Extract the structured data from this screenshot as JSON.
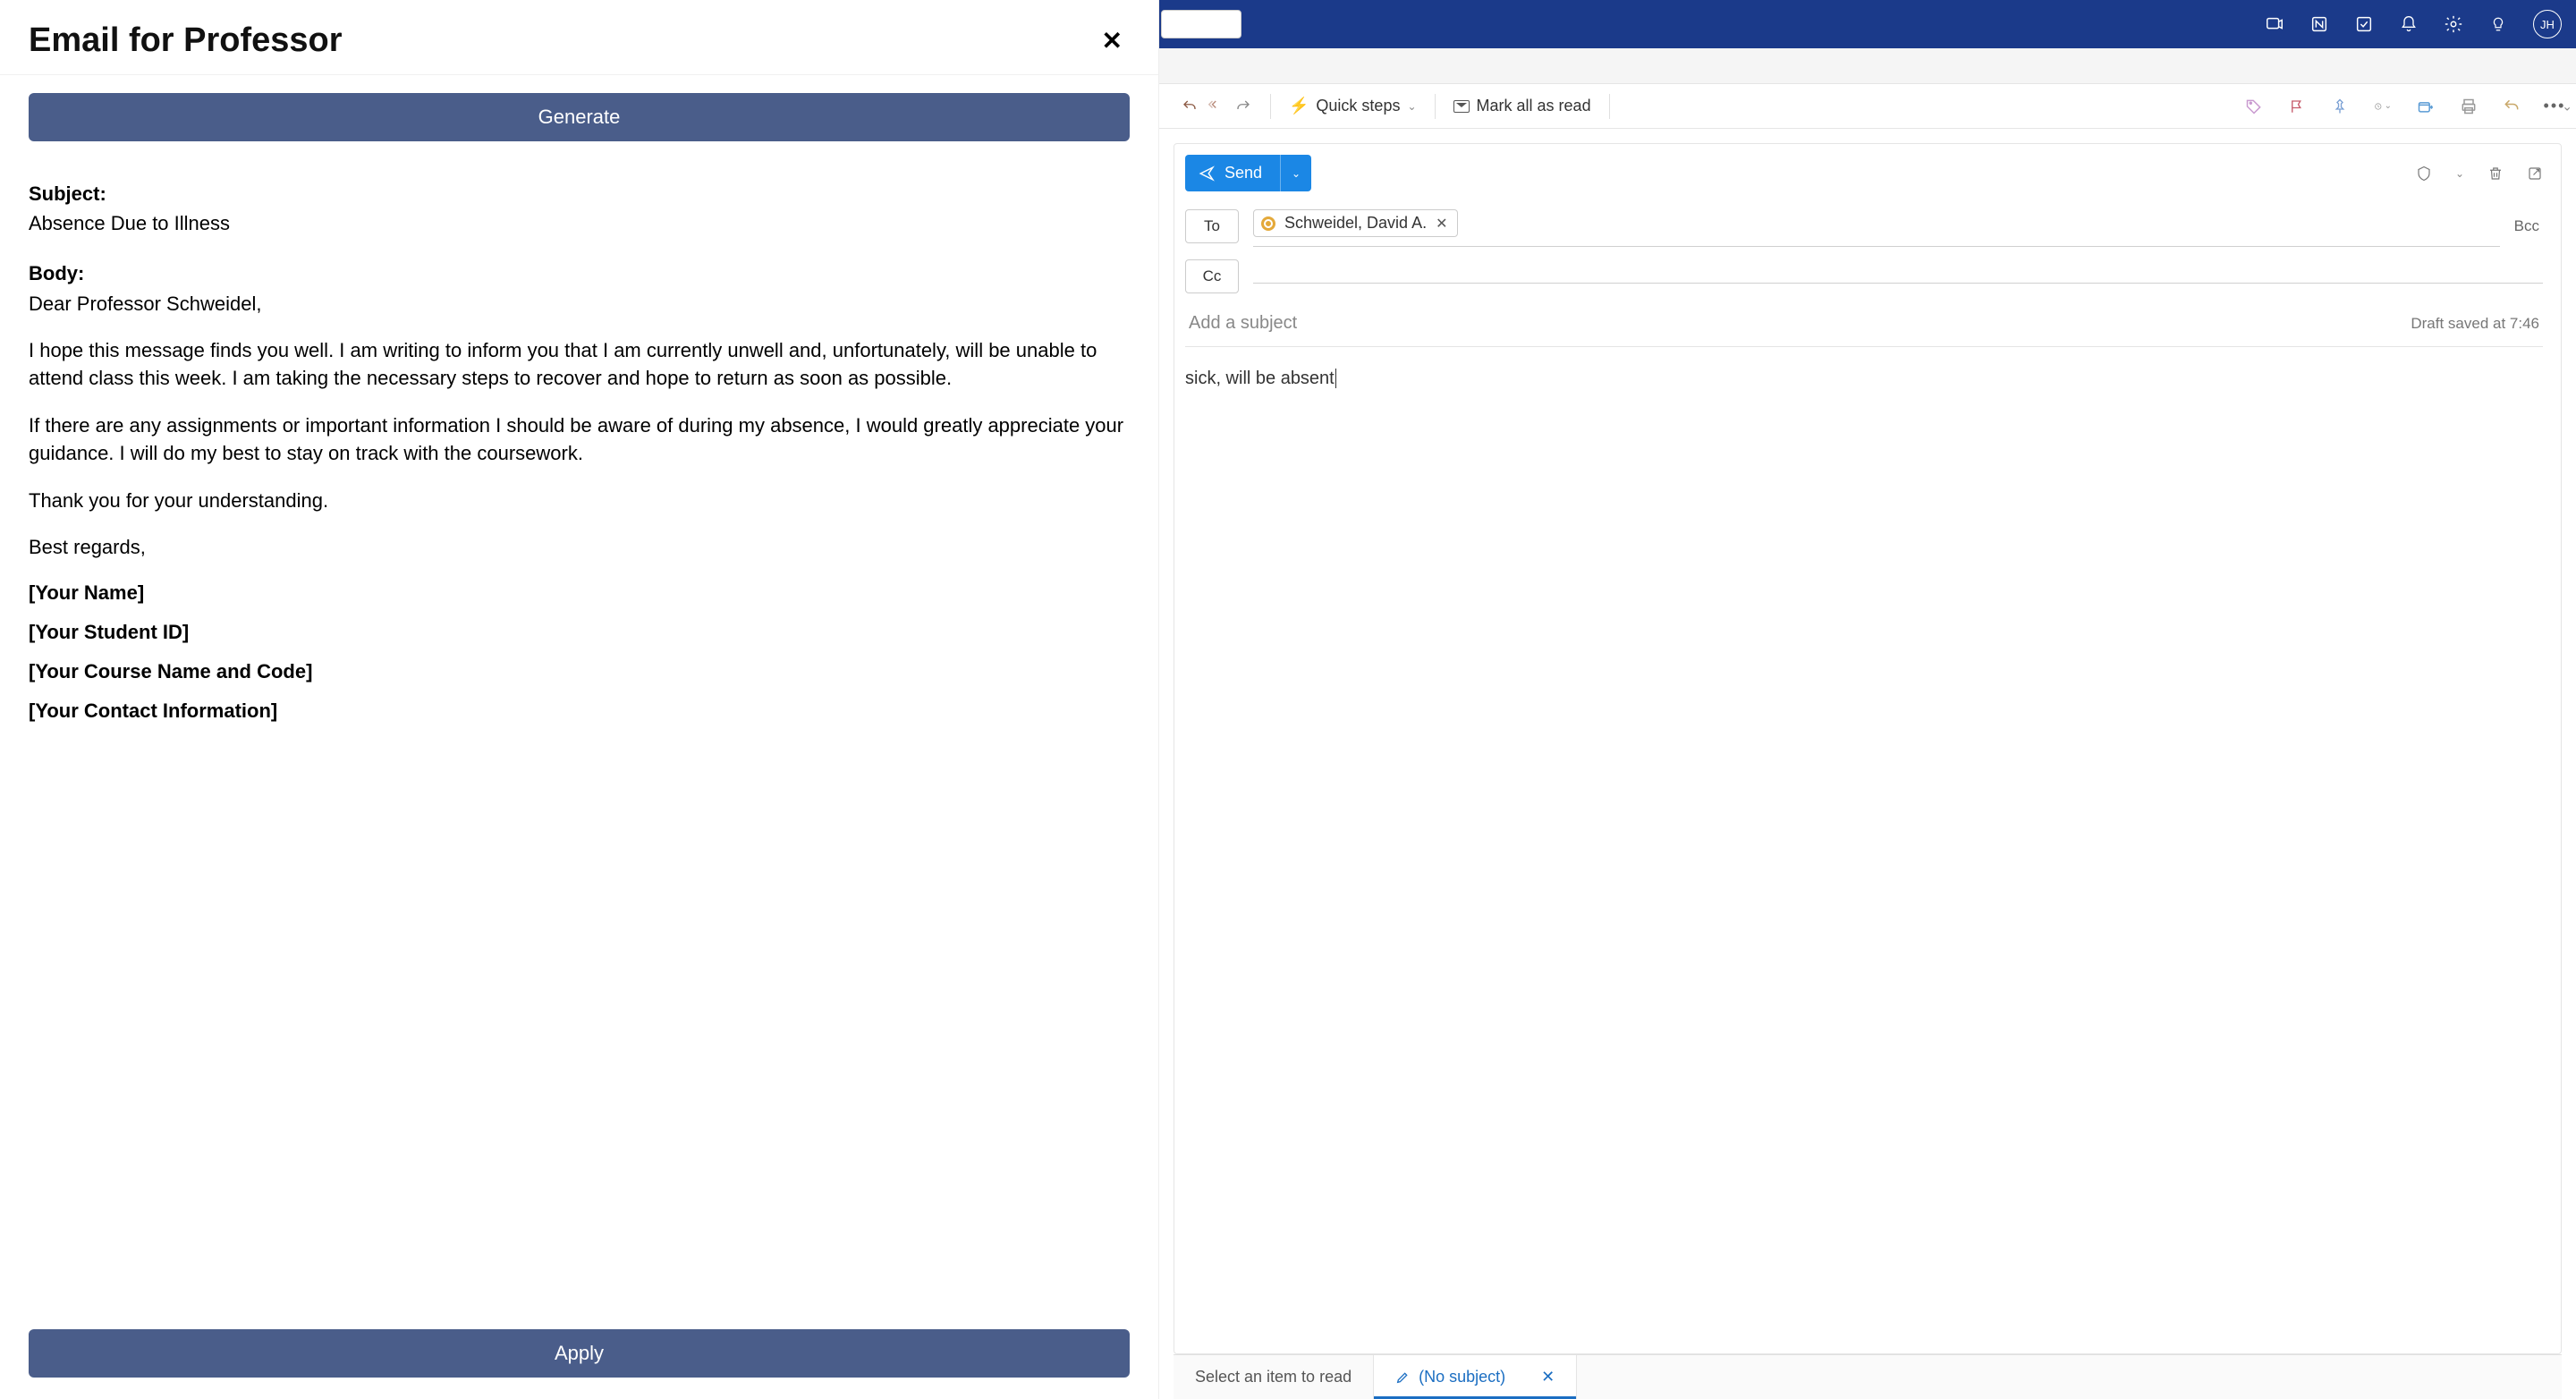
{
  "leftPanel": {
    "title": "Email for Professor",
    "generateLabel": "Generate",
    "subjectLabel": "Subject:",
    "subjectValue": "Absence Due to Illness",
    "bodyLabel": "Body:",
    "salutation": "Dear Professor Schweidel,",
    "para1": "I hope this message finds you well. I am writing to inform you that I am currently unwell and, unfortunately, will be unable to attend class this week. I am taking the necessary steps to recover and hope to return as soon as possible.",
    "para2": "If there are any assignments or important information I should be aware of during my absence, I would greatly appreciate your guidance. I will do my best to stay on track with the coursework.",
    "para3": "Thank you for your understanding.",
    "signoff": "Best regards,",
    "placeholders": {
      "name": "[Your Name]",
      "studentId": "[Your Student ID]",
      "course": "[Your Course Name and Code]",
      "contact": "[Your Contact Information]"
    },
    "applyLabel": "Apply"
  },
  "topbar": {
    "avatar": "JH"
  },
  "ribbon": {
    "quickSteps": "Quick steps",
    "markAllRead": "Mark all as read"
  },
  "compose": {
    "sendLabel": "Send",
    "toLabel": "To",
    "ccLabel": "Cc",
    "bccLabel": "Bcc",
    "recipient": "Schweidel, David A.",
    "subjectPlaceholder": "Add a subject",
    "draftSaved": "Draft saved at 7:46",
    "bodyText": "sick, will be absent"
  },
  "tabs": {
    "selectItem": "Select an item to read",
    "noSubject": "(No subject)"
  }
}
